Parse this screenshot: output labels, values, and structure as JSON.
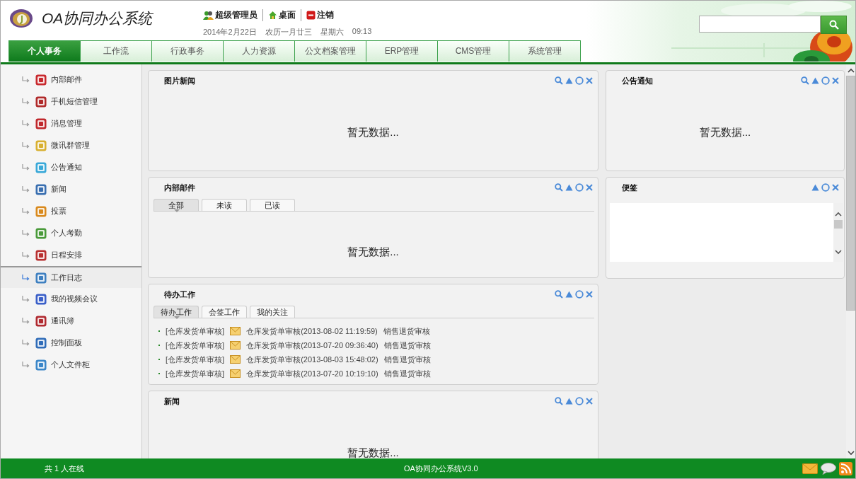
{
  "header": {
    "title": "OA协同办公系统",
    "user_links": [
      {
        "kind": "user",
        "label": "超级管理员"
      },
      {
        "kind": "desktop",
        "label": "桌面"
      },
      {
        "kind": "logout",
        "label": "注销"
      }
    ],
    "date_parts": [
      "2014年2月22日",
      "农历一月廿三",
      "星期六",
      "09:13"
    ]
  },
  "nav_tabs": [
    {
      "label": "个人事务",
      "selected": true
    },
    {
      "label": "工作流",
      "selected": false
    },
    {
      "label": "行政事务",
      "selected": false
    },
    {
      "label": "人力资源",
      "selected": false
    },
    {
      "label": "公文档案管理",
      "selected": false
    },
    {
      "label": "ERP管理",
      "selected": false
    },
    {
      "label": "CMS管理",
      "selected": false
    },
    {
      "label": "系统管理",
      "selected": false
    }
  ],
  "sidebar": {
    "items": [
      {
        "label": "内部邮件",
        "selected": false
      },
      {
        "label": "手机短信管理",
        "selected": false
      },
      {
        "label": "消息管理",
        "selected": false
      },
      {
        "label": "微讯群管理",
        "selected": false
      },
      {
        "label": "公告通知",
        "selected": false
      },
      {
        "label": "新闻",
        "selected": false
      },
      {
        "label": "投票",
        "selected": false
      },
      {
        "label": "个人考勤",
        "selected": false
      },
      {
        "label": "日程安排",
        "selected": false
      },
      {
        "label": "工作日志",
        "selected": true
      },
      {
        "label": "我的视频会议",
        "selected": false
      },
      {
        "label": "通讯簿",
        "selected": false
      },
      {
        "label": "控制面板",
        "selected": false
      },
      {
        "label": "个人文件柜",
        "selected": false
      }
    ]
  },
  "columns": [
    {
      "panels": [
        {
          "kind": "empty",
          "title": "图片新闻",
          "search_button": true,
          "message": "暂无数据..."
        },
        {
          "kind": "tabbed",
          "title": "内部邮件",
          "search_button": true,
          "tabs": [
            {
              "label": "全部",
              "selected": true
            },
            {
              "label": "未读",
              "selected": false
            },
            {
              "label": "已读",
              "selected": false
            }
          ],
          "message": "暂无数据..."
        },
        {
          "kind": "tabbed",
          "title": "待办工作",
          "search_button": true,
          "tabs": [
            {
              "label": "待办工作",
              "selected": true
            },
            {
              "label": "会签工作",
              "selected": false
            },
            {
              "label": "我的关注",
              "selected": false
            }
          ],
          "items": [
            {
              "category": "[仓库发货单审核]",
              "subject": "仓库发货单审核(2013-08-02 11:19:59)",
              "step": "销售退货审核"
            },
            {
              "category": "[仓库发货单审核]",
              "subject": "仓库发货单审核(2013-07-20 09:36:40)",
              "step": "销售退货审核"
            },
            {
              "category": "[仓库发货单审核]",
              "subject": "仓库发货单审核(2013-08-03 15:48:02)",
              "step": "销售退货审核"
            },
            {
              "category": "[仓库发货单审核]",
              "subject": "仓库发货单审核(2013-07-20 10:19:10)",
              "step": "销售退货审核"
            }
          ]
        },
        {
          "kind": "empty",
          "title": "新闻",
          "search_button": true,
          "message": "暂无数据..."
        }
      ]
    },
    {
      "panels": [
        {
          "kind": "empty",
          "title": "公告通知",
          "search_button": true,
          "message": "暂无数据..."
        },
        {
          "kind": "note",
          "title": "便签",
          "search_button": false
        }
      ]
    }
  ],
  "status_bar": {
    "online": "共 1 人在线",
    "product": "OA协同办公系统V3.0"
  }
}
